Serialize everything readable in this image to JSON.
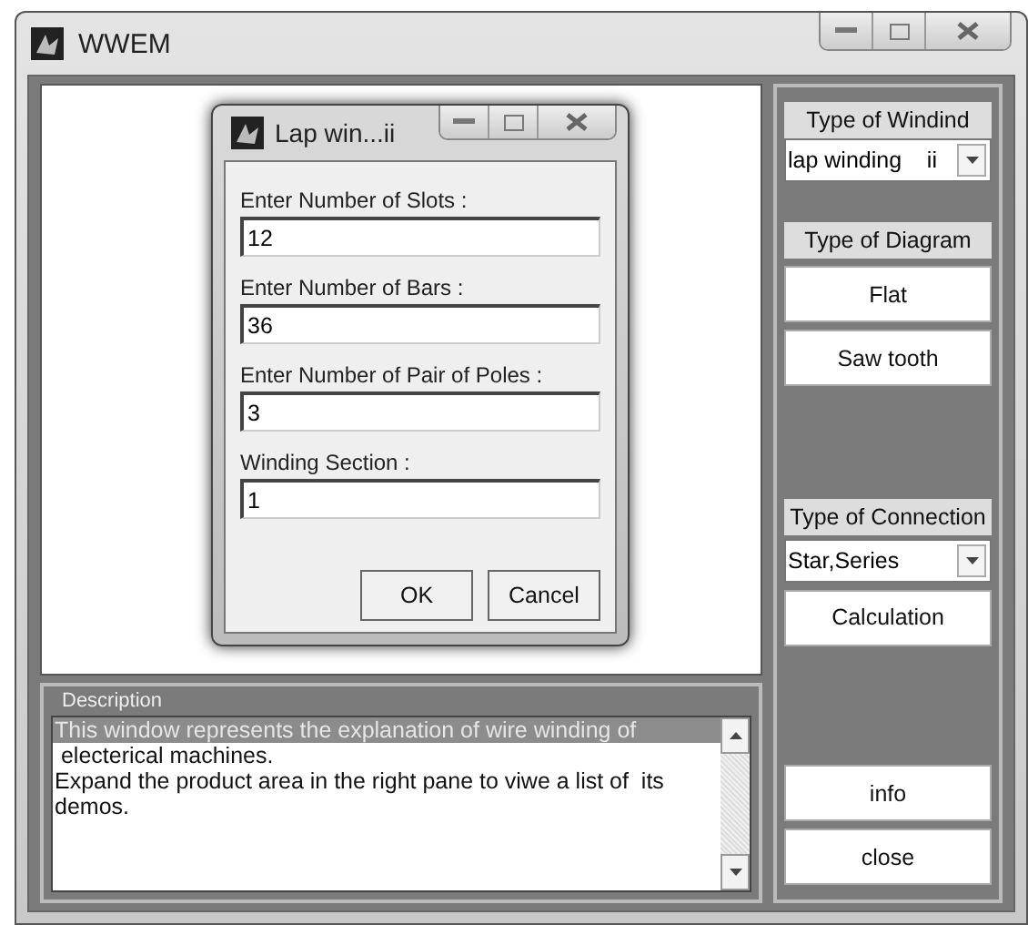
{
  "window": {
    "title": "WWEM"
  },
  "dialog": {
    "title": "Lap win...ii",
    "fields": [
      {
        "label": "Enter Number of Slots :",
        "value": "12"
      },
      {
        "label": "Enter Number of Bars :",
        "value": "36"
      },
      {
        "label": "Enter Number of Pair of Poles :",
        "value": "3"
      },
      {
        "label": "Winding Section :",
        "value": "1"
      }
    ],
    "buttons": [
      "OK",
      "Cancel"
    ]
  },
  "description": {
    "title": "Description",
    "lines": [
      {
        "text": "This window represents the explanation of wire winding of",
        "selected": true
      },
      {
        "text": " electerical machines.",
        "selected": false
      },
      {
        "text": "Expand the product area in the right pane to viwe a list of  its",
        "selected": false
      },
      {
        "text": "demos.",
        "selected": false
      }
    ]
  },
  "right_panel": {
    "winding": {
      "label": "Type of  Windind",
      "value": "lap winding    ii"
    },
    "diagram": {
      "label": "Type of  Diagram",
      "buttons": [
        "Flat",
        "Saw tooth"
      ]
    },
    "connection": {
      "label": "Type of  Connection",
      "value": "Star,Series",
      "button": "Calculation"
    },
    "buttons": [
      "info",
      "close"
    ]
  }
}
